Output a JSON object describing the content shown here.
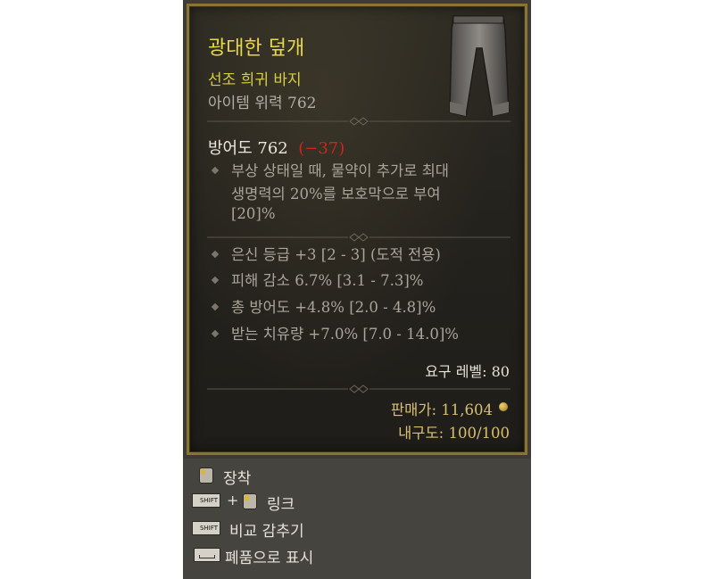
{
  "item": {
    "name": "광대한 덮개",
    "type": "선조 희귀 바지",
    "power_label": "아이템 위력 762",
    "armor_label": "방어도 762",
    "armor_diff": "(−37)",
    "implicit_lines": [
      "부상 상태일 때, 물약이 추가로 최대",
      "생명력의 20%를 보호막으로 부여",
      "[20]%"
    ],
    "affixes": [
      "은신 등급 +3 [2 - 3] (도적 전용)",
      "피해 감소 6.7% [3.1 - 7.3]%",
      "총 방어도 +4.8% [2.0 - 4.8]%",
      "받는 치유량 +7.0% [7.0 - 14.0]%"
    ],
    "required_level": "요구 레벨: 80",
    "sell_value": "판매가: 11,604",
    "durability": "내구도: 100/100",
    "icon": "pants-icon"
  },
  "actions": {
    "equip": "장착",
    "link": "링크",
    "hide_compare": "비교 감추기",
    "salvage": "폐품으로 표시",
    "plus": "+",
    "shift_key": "SHIFT"
  },
  "colors": {
    "title": "#e6d84a",
    "rare_text": "#d9cc3f",
    "negative": "#d0241c",
    "frame_gold": "#8a7432",
    "gold_text": "#d8c06e"
  }
}
